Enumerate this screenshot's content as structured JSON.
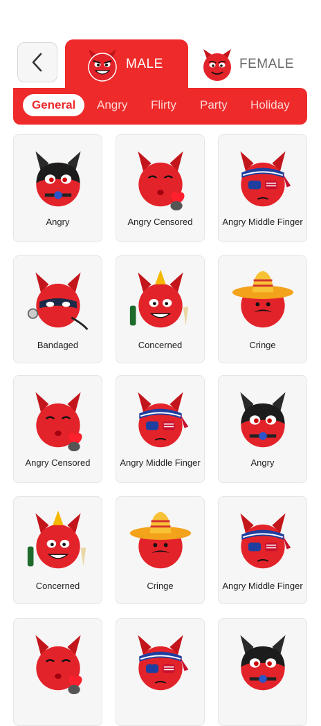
{
  "header": {
    "tabs": [
      {
        "label": "MALE",
        "active": true
      },
      {
        "label": "FEMALE",
        "active": false
      }
    ]
  },
  "categories": [
    "General",
    "Angry",
    "Flirty",
    "Party",
    "Holiday"
  ],
  "active_category": "General",
  "grid": {
    "items": [
      {
        "label": "Angry",
        "icon": "black-mask-devil-icon"
      },
      {
        "label": "Angry Censored",
        "icon": "kissing-devil-icon"
      },
      {
        "label": "Angry Middle Finger",
        "icon": "usa-bandana-devil-icon"
      },
      {
        "label": "Bandaged",
        "icon": "masked-whip-devil-icon"
      },
      {
        "label": "Concerned",
        "icon": "party-devil-icon"
      },
      {
        "label": "Cringe",
        "icon": "sombrero-devil-icon"
      },
      {
        "label": "Angry Censored",
        "icon": "kissing-devil-icon"
      },
      {
        "label": "Angry Middle Finger",
        "icon": "usa-bandana-devil-icon"
      },
      {
        "label": "Angry",
        "icon": "black-mask-devil-icon"
      },
      {
        "label": "Concerned",
        "icon": "party-devil-icon"
      },
      {
        "label": "Cringe",
        "icon": "sombrero-devil-icon"
      },
      {
        "label": "Angry Middle Finger",
        "icon": "usa-bandana-devil-icon"
      },
      {
        "label": "",
        "icon": "kissing-devil-icon"
      },
      {
        "label": "",
        "icon": "usa-bandana-devil-icon"
      },
      {
        "label": "",
        "icon": "black-mask-devil-icon"
      }
    ]
  },
  "colors": {
    "accent": "#ee2a2a",
    "card_bg": "#f6f6f6"
  }
}
